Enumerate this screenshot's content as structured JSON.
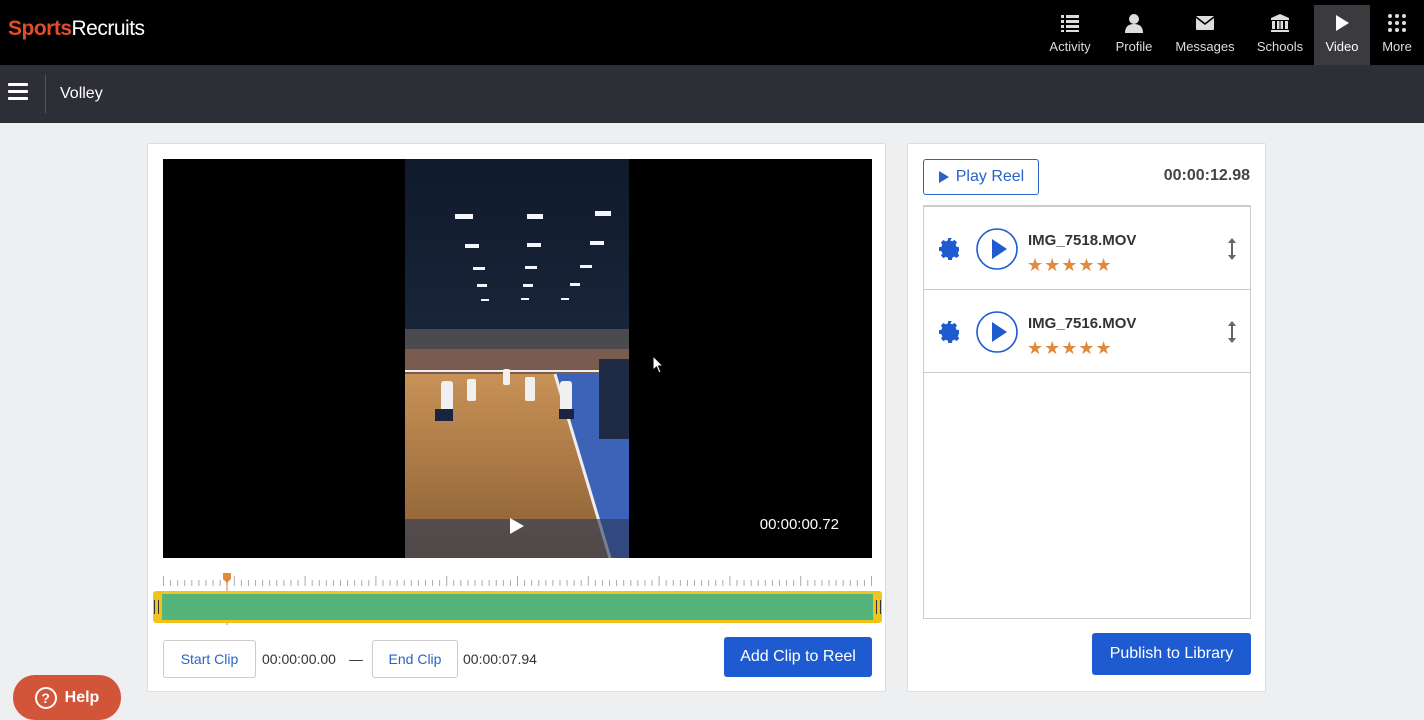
{
  "brand": {
    "part1": "Sports",
    "part2": "Recruits"
  },
  "nav": {
    "items": [
      {
        "label": "Activity",
        "icon": "list-icon"
      },
      {
        "label": "Profile",
        "icon": "person-icon"
      },
      {
        "label": "Messages",
        "icon": "envelope-icon"
      },
      {
        "label": "Schools",
        "icon": "institution-icon"
      },
      {
        "label": "Video",
        "icon": "play-icon",
        "active": true
      },
      {
        "label": "More",
        "icon": "grid-icon"
      }
    ]
  },
  "subheader": {
    "title": "Volley"
  },
  "player": {
    "timecode": "00:00:00.72",
    "playhead_fraction": 0.09
  },
  "clip": {
    "start_label": "Start Clip",
    "start_time": "00:00:00.00",
    "separator": "—",
    "end_label": "End Clip",
    "end_time": "00:00:07.94",
    "add_label": "Add Clip to Reel"
  },
  "reel": {
    "play_label": "Play Reel",
    "total_time": "00:00:12.98",
    "items": [
      {
        "name": "IMG_7518.MOV",
        "stars": "★★★★★"
      },
      {
        "name": "IMG_7516.MOV",
        "stars": "★★★★★"
      }
    ],
    "publish_label": "Publish to Library"
  },
  "help": {
    "label": "Help",
    "glyph": "?"
  },
  "colors": {
    "accent": "#1e5bd1",
    "brand": "#e34b2a",
    "track": "#55b47a",
    "trim": "#f1c31d",
    "star": "#e08a3c",
    "help": "#d2553a"
  }
}
